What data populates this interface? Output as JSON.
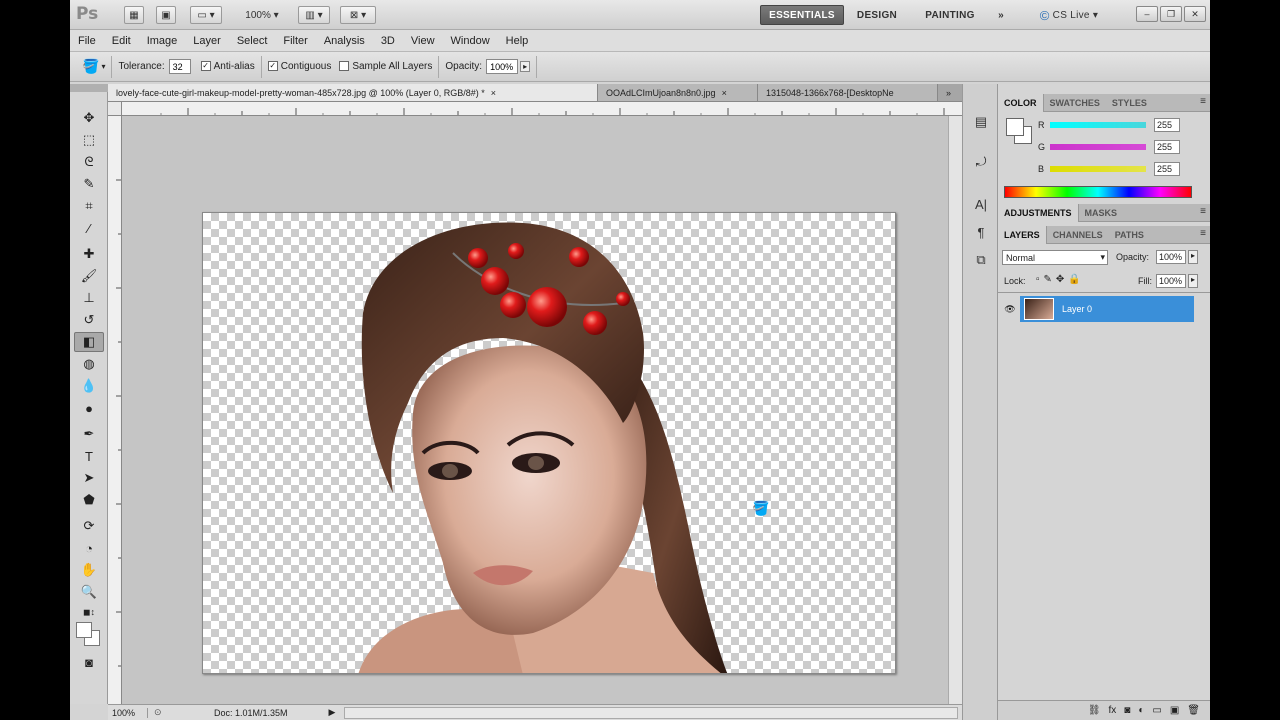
{
  "app": {
    "logo": "Ps",
    "zoom_display": "100%",
    "workspaces": {
      "essentials": "ESSENTIALS",
      "design": "DESIGN",
      "painting": "PAINTING",
      "more": "»"
    },
    "cs_live": "CS Live",
    "window_controls": [
      "–",
      "❐",
      "✕"
    ]
  },
  "menu": [
    "File",
    "Edit",
    "Image",
    "Layer",
    "Select",
    "Filter",
    "Analysis",
    "3D",
    "View",
    "Window",
    "Help"
  ],
  "options": {
    "tolerance_label": "Tolerance:",
    "tolerance_value": "32",
    "anti_alias": "Anti-alias",
    "contiguous": "Contiguous",
    "sample_all_layers": "Sample All Layers",
    "opacity_label": "Opacity:",
    "opacity_value": "100%"
  },
  "tabs": [
    {
      "label": "lovely-face-cute-girl-makeup-model-pretty-woman-485x728.jpg @ 100% (Layer 0, RGB/8#) *",
      "close": "×"
    },
    {
      "label": "OOAdLCImUjoan8n8n0.jpg",
      "close": "×"
    },
    {
      "label": "1315048-1366x768-[DesktopNe",
      "close": ""
    }
  ],
  "tabs_more": "»",
  "status": {
    "zoom": "100%",
    "doc": "Doc: 1.01M/1.35M"
  },
  "color_panel": {
    "tabs": [
      "COLOR",
      "SWATCHES",
      "STYLES"
    ],
    "channels": [
      {
        "label": "R",
        "value": "255",
        "color": "#49d6dc"
      },
      {
        "label": "G",
        "value": "255",
        "color": "#d64bd6"
      },
      {
        "label": "B",
        "value": "255",
        "color": "#e4e44a"
      }
    ]
  },
  "adjust_panel": {
    "tabs": [
      "ADJUSTMENTS",
      "MASKS"
    ]
  },
  "layers_panel": {
    "tabs": [
      "LAYERS",
      "CHANNELS",
      "PATHS"
    ],
    "blend_mode": "Normal",
    "opacity_label": "Opacity:",
    "opacity_value": "100%",
    "lock_label": "Lock:",
    "fill_label": "Fill:",
    "fill_value": "100%",
    "layer_name": "Layer 0"
  },
  "colors": {
    "selection": "#3a8fd9",
    "accent_dark": "#5c5c5c"
  }
}
